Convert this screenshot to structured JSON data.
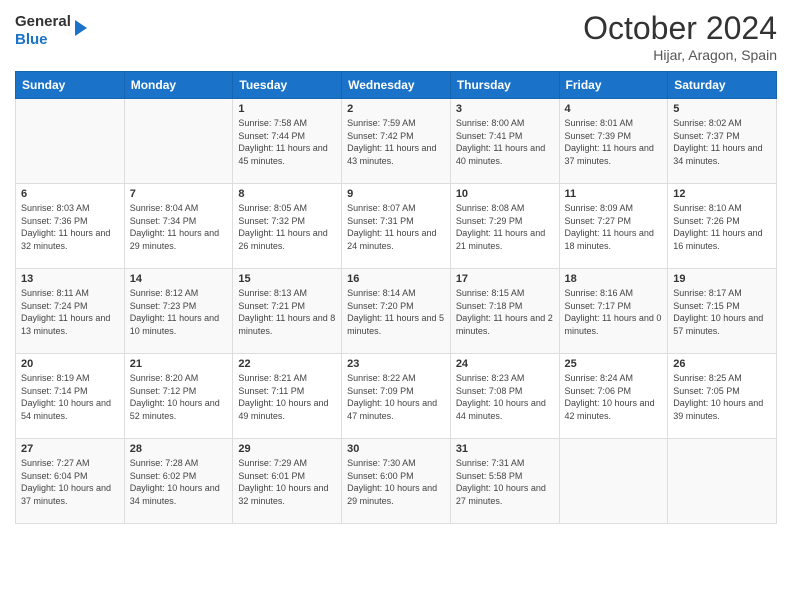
{
  "logo": {
    "line1": "General",
    "line2": "Blue"
  },
  "title": "October 2024",
  "subtitle": "Hijar, Aragon, Spain",
  "headers": [
    "Sunday",
    "Monday",
    "Tuesday",
    "Wednesday",
    "Thursday",
    "Friday",
    "Saturday"
  ],
  "weeks": [
    [
      {
        "day": "",
        "sunrise": "",
        "sunset": "",
        "daylight": ""
      },
      {
        "day": "",
        "sunrise": "",
        "sunset": "",
        "daylight": ""
      },
      {
        "day": "1",
        "sunrise": "Sunrise: 7:58 AM",
        "sunset": "Sunset: 7:44 PM",
        "daylight": "Daylight: 11 hours and 45 minutes."
      },
      {
        "day": "2",
        "sunrise": "Sunrise: 7:59 AM",
        "sunset": "Sunset: 7:42 PM",
        "daylight": "Daylight: 11 hours and 43 minutes."
      },
      {
        "day": "3",
        "sunrise": "Sunrise: 8:00 AM",
        "sunset": "Sunset: 7:41 PM",
        "daylight": "Daylight: 11 hours and 40 minutes."
      },
      {
        "day": "4",
        "sunrise": "Sunrise: 8:01 AM",
        "sunset": "Sunset: 7:39 PM",
        "daylight": "Daylight: 11 hours and 37 minutes."
      },
      {
        "day": "5",
        "sunrise": "Sunrise: 8:02 AM",
        "sunset": "Sunset: 7:37 PM",
        "daylight": "Daylight: 11 hours and 34 minutes."
      }
    ],
    [
      {
        "day": "6",
        "sunrise": "Sunrise: 8:03 AM",
        "sunset": "Sunset: 7:36 PM",
        "daylight": "Daylight: 11 hours and 32 minutes."
      },
      {
        "day": "7",
        "sunrise": "Sunrise: 8:04 AM",
        "sunset": "Sunset: 7:34 PM",
        "daylight": "Daylight: 11 hours and 29 minutes."
      },
      {
        "day": "8",
        "sunrise": "Sunrise: 8:05 AM",
        "sunset": "Sunset: 7:32 PM",
        "daylight": "Daylight: 11 hours and 26 minutes."
      },
      {
        "day": "9",
        "sunrise": "Sunrise: 8:07 AM",
        "sunset": "Sunset: 7:31 PM",
        "daylight": "Daylight: 11 hours and 24 minutes."
      },
      {
        "day": "10",
        "sunrise": "Sunrise: 8:08 AM",
        "sunset": "Sunset: 7:29 PM",
        "daylight": "Daylight: 11 hours and 21 minutes."
      },
      {
        "day": "11",
        "sunrise": "Sunrise: 8:09 AM",
        "sunset": "Sunset: 7:27 PM",
        "daylight": "Daylight: 11 hours and 18 minutes."
      },
      {
        "day": "12",
        "sunrise": "Sunrise: 8:10 AM",
        "sunset": "Sunset: 7:26 PM",
        "daylight": "Daylight: 11 hours and 16 minutes."
      }
    ],
    [
      {
        "day": "13",
        "sunrise": "Sunrise: 8:11 AM",
        "sunset": "Sunset: 7:24 PM",
        "daylight": "Daylight: 11 hours and 13 minutes."
      },
      {
        "day": "14",
        "sunrise": "Sunrise: 8:12 AM",
        "sunset": "Sunset: 7:23 PM",
        "daylight": "Daylight: 11 hours and 10 minutes."
      },
      {
        "day": "15",
        "sunrise": "Sunrise: 8:13 AM",
        "sunset": "Sunset: 7:21 PM",
        "daylight": "Daylight: 11 hours and 8 minutes."
      },
      {
        "day": "16",
        "sunrise": "Sunrise: 8:14 AM",
        "sunset": "Sunset: 7:20 PM",
        "daylight": "Daylight: 11 hours and 5 minutes."
      },
      {
        "day": "17",
        "sunrise": "Sunrise: 8:15 AM",
        "sunset": "Sunset: 7:18 PM",
        "daylight": "Daylight: 11 hours and 2 minutes."
      },
      {
        "day": "18",
        "sunrise": "Sunrise: 8:16 AM",
        "sunset": "Sunset: 7:17 PM",
        "daylight": "Daylight: 11 hours and 0 minutes."
      },
      {
        "day": "19",
        "sunrise": "Sunrise: 8:17 AM",
        "sunset": "Sunset: 7:15 PM",
        "daylight": "Daylight: 10 hours and 57 minutes."
      }
    ],
    [
      {
        "day": "20",
        "sunrise": "Sunrise: 8:19 AM",
        "sunset": "Sunset: 7:14 PM",
        "daylight": "Daylight: 10 hours and 54 minutes."
      },
      {
        "day": "21",
        "sunrise": "Sunrise: 8:20 AM",
        "sunset": "Sunset: 7:12 PM",
        "daylight": "Daylight: 10 hours and 52 minutes."
      },
      {
        "day": "22",
        "sunrise": "Sunrise: 8:21 AM",
        "sunset": "Sunset: 7:11 PM",
        "daylight": "Daylight: 10 hours and 49 minutes."
      },
      {
        "day": "23",
        "sunrise": "Sunrise: 8:22 AM",
        "sunset": "Sunset: 7:09 PM",
        "daylight": "Daylight: 10 hours and 47 minutes."
      },
      {
        "day": "24",
        "sunrise": "Sunrise: 8:23 AM",
        "sunset": "Sunset: 7:08 PM",
        "daylight": "Daylight: 10 hours and 44 minutes."
      },
      {
        "day": "25",
        "sunrise": "Sunrise: 8:24 AM",
        "sunset": "Sunset: 7:06 PM",
        "daylight": "Daylight: 10 hours and 42 minutes."
      },
      {
        "day": "26",
        "sunrise": "Sunrise: 8:25 AM",
        "sunset": "Sunset: 7:05 PM",
        "daylight": "Daylight: 10 hours and 39 minutes."
      }
    ],
    [
      {
        "day": "27",
        "sunrise": "Sunrise: 7:27 AM",
        "sunset": "Sunset: 6:04 PM",
        "daylight": "Daylight: 10 hours and 37 minutes."
      },
      {
        "day": "28",
        "sunrise": "Sunrise: 7:28 AM",
        "sunset": "Sunset: 6:02 PM",
        "daylight": "Daylight: 10 hours and 34 minutes."
      },
      {
        "day": "29",
        "sunrise": "Sunrise: 7:29 AM",
        "sunset": "Sunset: 6:01 PM",
        "daylight": "Daylight: 10 hours and 32 minutes."
      },
      {
        "day": "30",
        "sunrise": "Sunrise: 7:30 AM",
        "sunset": "Sunset: 6:00 PM",
        "daylight": "Daylight: 10 hours and 29 minutes."
      },
      {
        "day": "31",
        "sunrise": "Sunrise: 7:31 AM",
        "sunset": "Sunset: 5:58 PM",
        "daylight": "Daylight: 10 hours and 27 minutes."
      },
      {
        "day": "",
        "sunrise": "",
        "sunset": "",
        "daylight": ""
      },
      {
        "day": "",
        "sunrise": "",
        "sunset": "",
        "daylight": ""
      }
    ]
  ]
}
